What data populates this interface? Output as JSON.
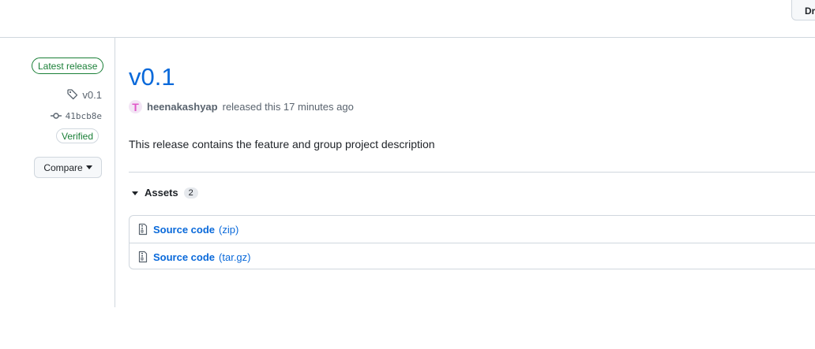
{
  "header": {
    "button_label": "Draft"
  },
  "sidebar": {
    "latest_badge": "Latest release",
    "tag": "v0.1",
    "commit": "41bcb8e",
    "verified": "Verified",
    "compare": "Compare"
  },
  "release": {
    "title": "v0.1",
    "author": "heenakashyap",
    "released_text": "released this 17 minutes ago",
    "avatar_letter": "T",
    "description": "This release contains the feature and group project description"
  },
  "assets": {
    "label": "Assets",
    "count": "2",
    "items": [
      {
        "name": "Source code",
        "ext": "(zip)"
      },
      {
        "name": "Source code",
        "ext": "(tar.gz)"
      }
    ]
  },
  "colors": {
    "link": "#0969da",
    "success": "#1a7f37",
    "border": "#d0d7de"
  }
}
